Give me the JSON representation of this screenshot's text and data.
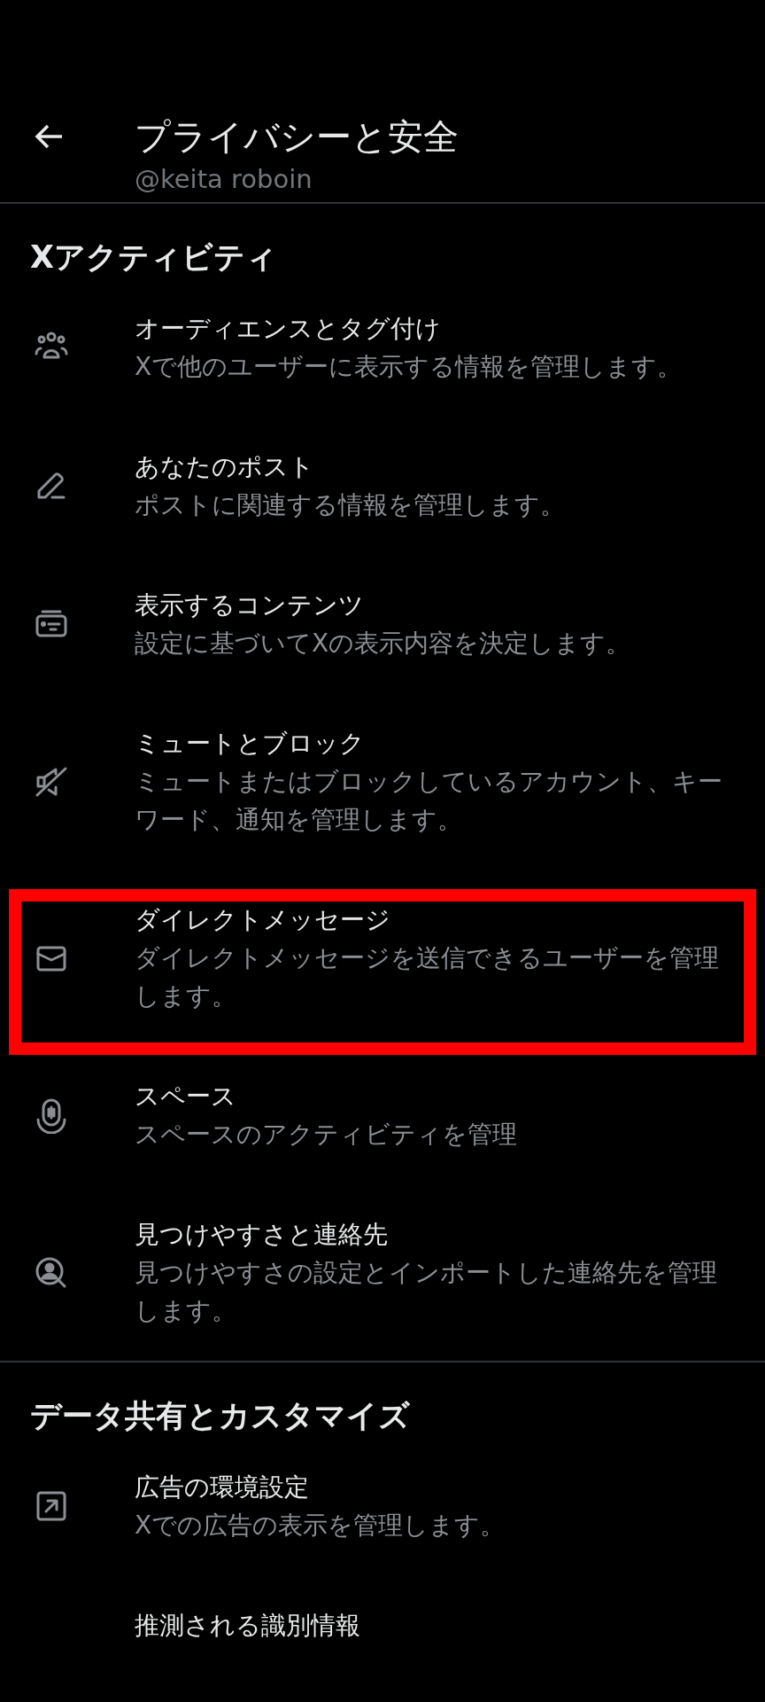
{
  "header": {
    "title": "プライバシーと安全",
    "handle": "@keita roboin"
  },
  "sections": [
    {
      "heading": "Xアクティビティ",
      "items": [
        {
          "title": "オーディエンスとタグ付け",
          "subtitle": "Xで他のユーザーに表示する情報を管理します。",
          "highlighted": false
        },
        {
          "title": "あなたのポスト",
          "subtitle": "ポストに関連する情報を管理します。",
          "highlighted": false
        },
        {
          "title": "表示するコンテンツ",
          "subtitle": "設定に基づいてXの表示内容を決定します。",
          "highlighted": false
        },
        {
          "title": "ミュートとブロック",
          "subtitle": "ミュートまたはブロックしているアカウント、キーワード、通知を管理します。",
          "highlighted": false
        },
        {
          "title": "ダイレクトメッセージ",
          "subtitle": "ダイレクトメッセージを送信できるユーザーを管理します。",
          "highlighted": true
        },
        {
          "title": "スペース",
          "subtitle": "スペースのアクティビティを管理",
          "highlighted": false
        },
        {
          "title": "見つけやすさと連絡先",
          "subtitle": "見つけやすさの設定とインポートした連絡先を管理します。",
          "highlighted": false
        }
      ]
    },
    {
      "heading": "データ共有とカスタマイズ",
      "items": [
        {
          "title": "広告の環境設定",
          "subtitle": "Xでの広告の表示を管理します。",
          "highlighted": false
        },
        {
          "title": "推測される識別情報",
          "highlighted": false
        }
      ]
    }
  ]
}
